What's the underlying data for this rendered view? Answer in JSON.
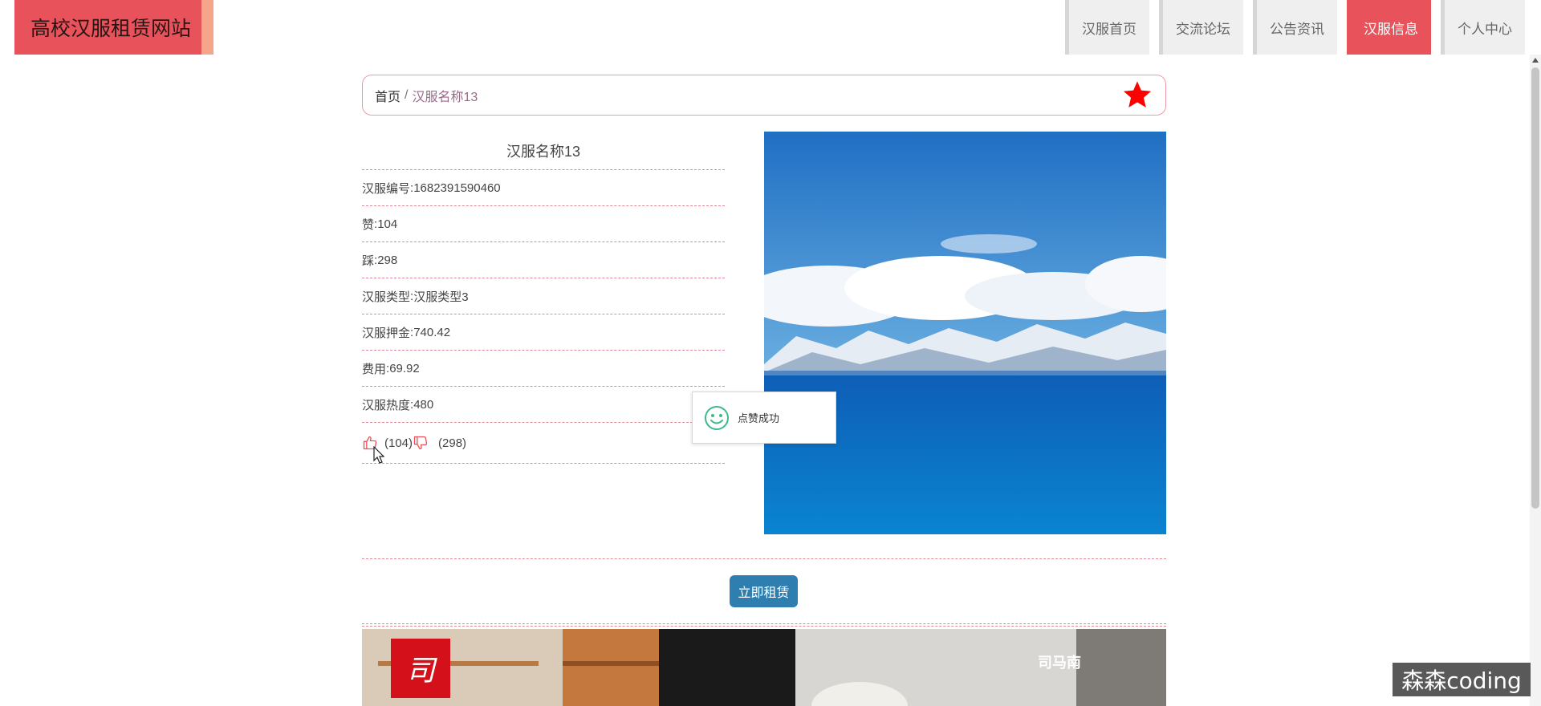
{
  "site": {
    "title": "高校汉服租赁网站"
  },
  "nav": {
    "items": [
      {
        "label": "汉服首页",
        "active": false
      },
      {
        "label": "交流论坛",
        "active": false
      },
      {
        "label": "公告资讯",
        "active": false
      },
      {
        "label": "汉服信息",
        "active": true
      },
      {
        "label": "个人中心",
        "active": false
      }
    ]
  },
  "breadcrumb": {
    "home": "首页",
    "separator": "/",
    "current": "汉服名称13"
  },
  "detail": {
    "name": "汉服名称13",
    "fields": [
      {
        "label": "汉服编号",
        "value": "1682391590460"
      },
      {
        "label": "赞",
        "value": "104"
      },
      {
        "label": "踩",
        "value": "298"
      },
      {
        "label": "汉服类型",
        "value": "汉服类型3"
      },
      {
        "label": "汉服押金",
        "value": "740.42"
      },
      {
        "label": "费用",
        "value": "69.92"
      },
      {
        "label": "汉服热度",
        "value": "480"
      }
    ],
    "likes": "(104)",
    "dislikes": "(298)"
  },
  "toast": {
    "message": "点赞成功"
  },
  "rent_button": "立即租赁",
  "banner": {
    "logo_char": "司",
    "brand_text": "司马南"
  },
  "watermark": "森森coding",
  "colors": {
    "accent": "#e8525a",
    "button": "#2e7fb0",
    "star": "#ff0000"
  }
}
